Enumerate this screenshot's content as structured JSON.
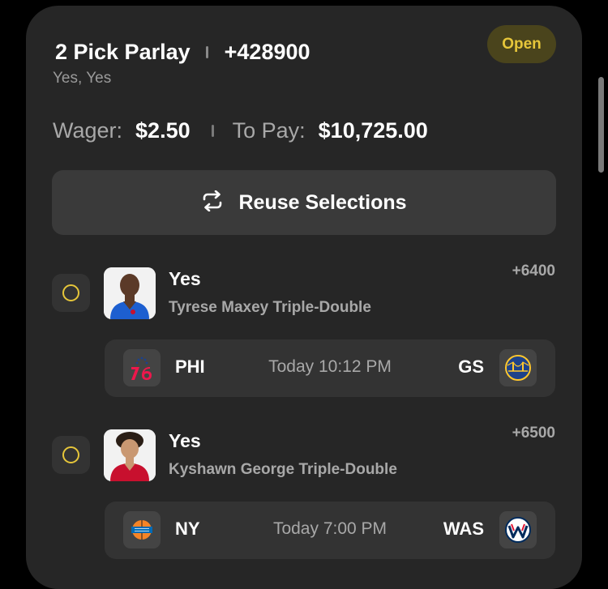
{
  "bet": {
    "title": "2 Pick Parlay",
    "odds": "+428900",
    "subtitle": "Yes, Yes",
    "status": "Open"
  },
  "wager": {
    "wager_label": "Wager:",
    "wager_value": "$2.50",
    "payout_label": "To Pay:",
    "payout_value": "$10,725.00"
  },
  "reuse": {
    "label": "Reuse Selections",
    "icon": "repeat-icon"
  },
  "legs": [
    {
      "pick": "Yes",
      "market": "Tyrese Maxey Triple-Double",
      "odds": "+6400",
      "jersey_color": "#1d5fd0",
      "game": {
        "away": "PHI",
        "time": "Today 10:12 PM",
        "home": "GS"
      }
    },
    {
      "pick": "Yes",
      "market": "Kyshawn George Triple-Double",
      "odds": "+6500",
      "jersey_color": "#c8102e",
      "game": {
        "away": "NY",
        "time": "Today 7:00 PM",
        "home": "WAS"
      }
    }
  ],
  "colors": {
    "accent": "#e6c63a",
    "card": "#262626",
    "button": "#3a3a3a"
  }
}
